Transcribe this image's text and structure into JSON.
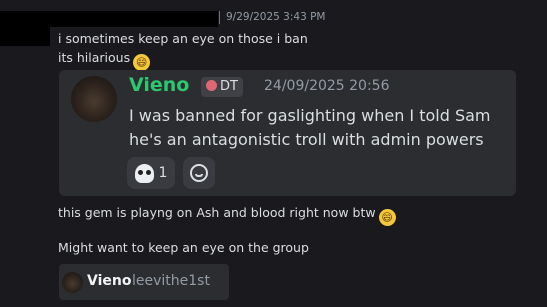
{
  "header": {
    "timestamp": "9/29/2025 3:43 PM"
  },
  "messages": [
    {
      "text": "i sometimes keep an eye on those i ban",
      "emoji": ""
    },
    {
      "text": "its hilarious",
      "emoji": "😄"
    },
    {
      "text": "this gem is playng on Ash and blood right now btw",
      "emoji": "😄"
    },
    {
      "text": "Might want to keep an eye on the group",
      "emoji": ""
    }
  ],
  "embed": {
    "author": "Vieno",
    "role_tag": "DT",
    "timestamp": "24/09/2025 20:56",
    "text": "I was banned for gaslighting when I told Sam he's an antagonistic troll with admin powers",
    "reactions": [
      {
        "icon": "skull-icon",
        "count": "1"
      }
    ],
    "add_reaction_icon": "add-reaction-icon"
  },
  "mention_chip": {
    "name": "Vieno",
    "handle": "leevithe1st"
  },
  "colors": {
    "background": "#1a1a1e",
    "embed_bg": "#2b2d31",
    "author_green": "#2dc770",
    "muted": "#949ba4"
  }
}
